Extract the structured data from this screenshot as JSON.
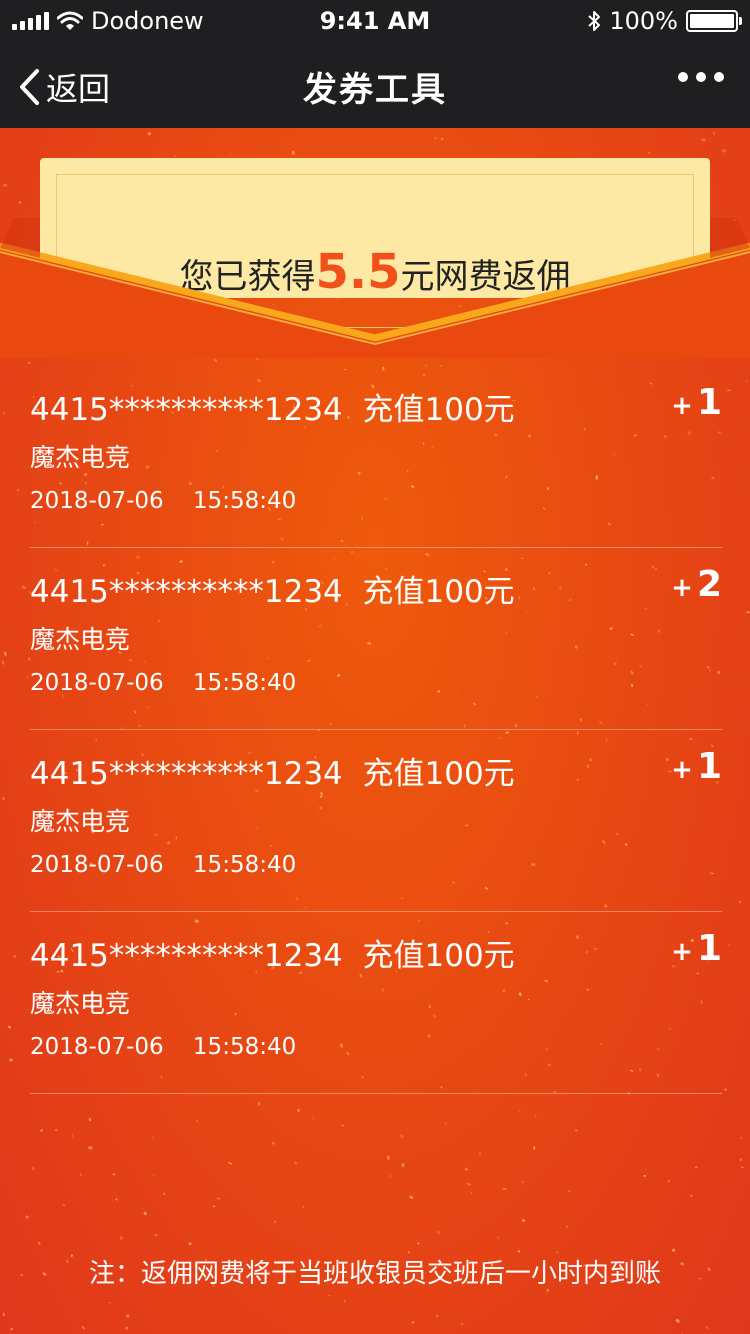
{
  "status_bar": {
    "carrier": "Dodonew",
    "time": "9:41 AM",
    "battery": "100%",
    "battery_level": 1.0
  },
  "nav": {
    "back_label": "返回",
    "title": "发券工具"
  },
  "summary": {
    "prefix": "您已获得",
    "amount": "5.5",
    "suffix": "元网费返佣"
  },
  "records": [
    {
      "card": "4415**********1234",
      "action": "充值100元",
      "shop": "魔杰电竞",
      "date": "2018-07-06",
      "time": "15:58:40",
      "delta_sign": "+",
      "delta": "1"
    },
    {
      "card": "4415**********1234",
      "action": "充值100元",
      "shop": "魔杰电竞",
      "date": "2018-07-06",
      "time": "15:58:40",
      "delta_sign": "+",
      "delta": "2"
    },
    {
      "card": "4415**********1234",
      "action": "充值100元",
      "shop": "魔杰电竞",
      "date": "2018-07-06",
      "time": "15:58:40",
      "delta_sign": "+",
      "delta": "1"
    },
    {
      "card": "4415**********1234",
      "action": "充值100元",
      "shop": "魔杰电竞",
      "date": "2018-07-06",
      "time": "15:58:40",
      "delta_sign": "+",
      "delta": "1"
    }
  ],
  "footer_note": "注：返佣网费将于当班收银员交班后一小时内到账",
  "colors": {
    "header_bg": "#1f1f22",
    "page_red": "#e84a12",
    "card_cream": "#fde8a4",
    "amount_orange": "#f2501a",
    "envelope_gold": "#f7a11a"
  }
}
